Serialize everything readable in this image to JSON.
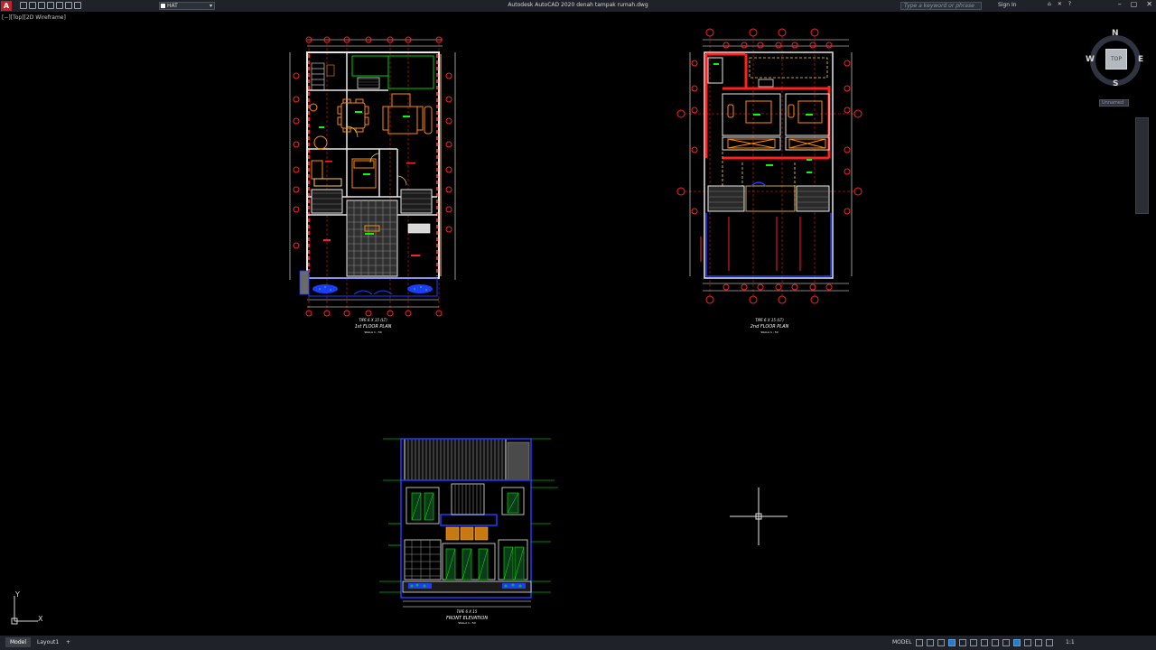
{
  "app": {
    "logo": "A",
    "title": "Autodesk AutoCAD 2020   denah tampak rumah.dwg",
    "layer_name": "HAT",
    "search_placeholder": "Type a keyword or phrase",
    "sign_in": "Sign In"
  },
  "viewport": {
    "label": "[−][Top][2D Wireframe]"
  },
  "viewcube": {
    "face": "TOP",
    "north": "N",
    "south": "S",
    "east": "E",
    "west": "W",
    "wcs": "Unnamed"
  },
  "drawings": {
    "plan1_title": "1st FLOOR PLAN",
    "plan1_sub": "TIPE 6 X 15 (LT)",
    "plan1_scale": "SKALA 1 : 50",
    "plan2_title": "2nd FLOOR PLAN",
    "plan2_sub": "TIPE 6 X 15 (LT)",
    "plan2_scale": "SKALA 1 : 50",
    "elev_title": "FRONT ELEVATION",
    "elev_sub": "TIPE 6 X 15",
    "elev_scale": "SKALA 1 : 50"
  },
  "ucs": {
    "x": "X",
    "y": "Y"
  },
  "statusbar": {
    "tabs": [
      "Model",
      "Layout1"
    ],
    "add_tab": "+",
    "mode": "MODEL",
    "scale": "1:1"
  },
  "colors": {
    "bg": "#000000",
    "wall": "#e8e8e8",
    "grid_line": "#ff2020",
    "dimension": "#ffffff",
    "furniture": "#ff8c00",
    "glass": "#1e3cff",
    "hatch": "#808080",
    "text_green": "#00ff00",
    "yellow": "#ffff00",
    "accent": "#2f78c4"
  }
}
